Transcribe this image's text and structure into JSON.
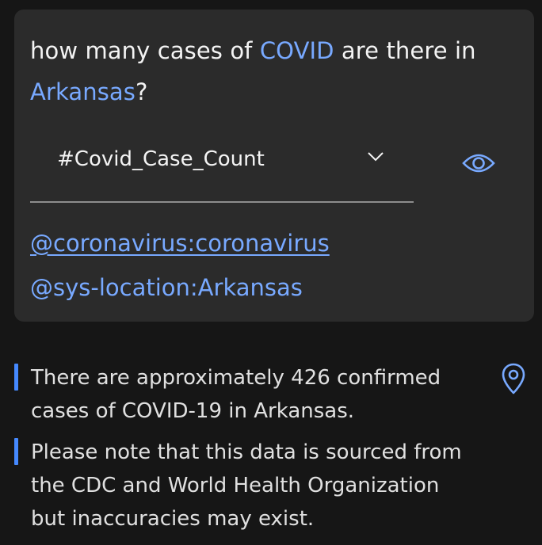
{
  "card": {
    "question": {
      "part1": "how many cases of ",
      "entity1": "COVID",
      "part2": " are there in ",
      "entity2": "Arkansas",
      "part3": "?"
    },
    "intent_select": {
      "value": "#Covid_Case_Count",
      "chevron_icon": "chevron-down-icon"
    },
    "view_icon": "eye-icon",
    "entities": [
      "@coronavirus:coronavirus",
      "@sys-location:Arkansas"
    ]
  },
  "responses": [
    {
      "text": "There are approximately 426 confirmed cases of COVID-19 in Arkansas."
    },
    {
      "text": "Please note that this data is sourced from the CDC and World Health Organization but inaccuracies may exist."
    }
  ],
  "location_icon": "location-pin-icon",
  "colors": {
    "background": "#161616",
    "card": "#2b2b2b",
    "accent": "#78a9ff",
    "response_bar": "#4589ff",
    "text": "#f4f4f4"
  }
}
